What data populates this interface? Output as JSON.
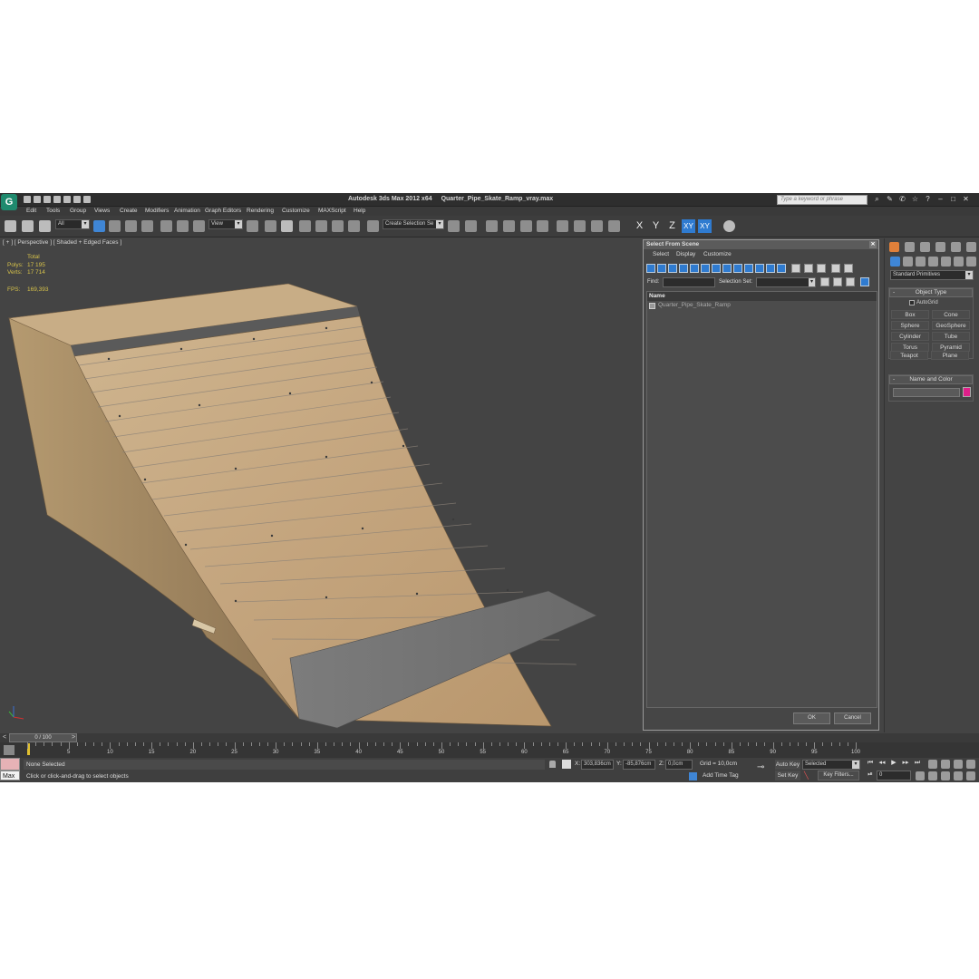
{
  "titlebar": {
    "app_title": "Autodesk 3ds Max  2012 x64",
    "file_name": "Quarter_Pipe_Skate_Ramp_vray.max",
    "help_search_placeholder": "Type a keyword or phrase"
  },
  "menubar": {
    "items": [
      "Edit",
      "Tools",
      "Group",
      "Views",
      "Create",
      "Modifiers",
      "Animation",
      "Graph Editors",
      "Rendering",
      "Customize",
      "MAXScript",
      "Help"
    ]
  },
  "toolbar": {
    "selection_filter": "All",
    "ref_coord": "View",
    "named_selection_set": "Create Selection Se",
    "axis": {
      "x": "X",
      "y": "Y",
      "z": "Z",
      "xy": "XY",
      "xy_alt": "XY"
    }
  },
  "viewport": {
    "label": "[ + ] [ Perspective ] [ Shaded + Edged Faces ]",
    "stats": {
      "header": "Total",
      "polys_label": "Polys:",
      "polys_value": "17 195",
      "verts_label": "Verts:",
      "verts_value": "17 714",
      "fps_label": "FPS:",
      "fps_value": "169,393"
    }
  },
  "select_from_scene": {
    "title": "Select From Scene",
    "menu": [
      "Select",
      "Display",
      "Customize"
    ],
    "find_label": "Find:",
    "find_value": "",
    "selection_set_label": "Selection Set:",
    "column_name": "Name",
    "objects": [
      "Quarter_Pipe_Skate_Ramp"
    ],
    "ok_label": "OK",
    "cancel_label": "Cancel"
  },
  "command_panel": {
    "category": "Standard Primitives",
    "object_type_title": "Object Type",
    "autogrid_label": "AutoGrid",
    "primitives": [
      "Box",
      "Cone",
      "Sphere",
      "GeoSphere",
      "Cylinder",
      "Tube",
      "Torus",
      "Pyramid",
      "Teapot",
      "Plane"
    ],
    "name_color_title": "Name and Color",
    "object_color": "#e0208a"
  },
  "timeline": {
    "slider_label": "0 / 100",
    "frame_labels": [
      "0",
      "5",
      "10",
      "15",
      "20",
      "25",
      "30",
      "35",
      "40",
      "45",
      "50",
      "55",
      "60",
      "65",
      "70",
      "75",
      "80",
      "85",
      "90",
      "95",
      "100"
    ],
    "current_frame": 0
  },
  "statusbar": {
    "maxscript_label": "Max",
    "selection_status": "None Selected",
    "prompt": "Click or click-and-drag to select objects",
    "x_label": "X:",
    "x_value": "303,836cm",
    "y_label": "Y:",
    "y_value": "-85,876cm",
    "z_label": "Z:",
    "z_value": "0,0cm",
    "grid": "Grid = 10,0cm",
    "add_time_tag": "Add Time Tag",
    "auto_key": "Auto Key",
    "set_key": "Set Key",
    "key_mode": "Selected",
    "key_filters": "Key Filters...",
    "frame_value": "0"
  },
  "colors": {
    "accent": "#2f7bd0",
    "stats_text": "#d6c24a",
    "viewport_bg": "#444444"
  }
}
